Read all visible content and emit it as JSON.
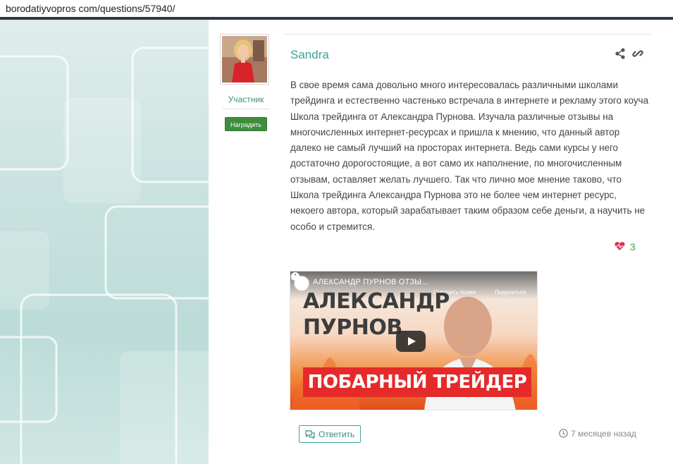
{
  "address_bar": {
    "url": "borodatiyvopros com/questions/57940/"
  },
  "author": {
    "name": "Sandra",
    "role": "Участник",
    "reward_button": "Наградить"
  },
  "answer": {
    "text": "В свое время сама довольно много интересовалась различными школами трейдинга и естественно частенько встречала в интернете и рекламу этого коуча Школа трейдинга от Александра Пурнова. Изучала различные отзывы на многочисленных интернет-ресурсах и пришла к мнению, что данный автор далеко не самый лучший на просторах интернета. Ведь сами курсы у него достаточно дорогостоящие, а вот само их наполнение, по многочисленным отзывам, оставляет желать лучшего. Так что лично мое мнение таково, что Школа трейдинга Александра Пурнова это не более чем интернет ресурс, некоего автора, который зарабатывает таким образом себе деньги, а научить не особо и стремится.",
    "likes": "3",
    "share_icon": "share-icon",
    "link_icon": "link-icon",
    "heart_icon": "heart-icon"
  },
  "video": {
    "title": "АЛЕКСАНДР ПУРНОВ ОТЗЫ...",
    "watch_later": "Смотреть позже",
    "share": "Поделиться",
    "headline_1": "АЛЕКСАНДР",
    "headline_2": "ПУРНОВ",
    "banner": "ПОБАРНЫЙ ТРЕЙДЕР"
  },
  "footer": {
    "reply_button": "Ответить",
    "time": "7 месяцев назад"
  },
  "colors": {
    "accent": "#3aa59a",
    "like_green": "#3aa543",
    "heart_red": "#d9304f",
    "reward_green": "#3f8e3f",
    "banner_red": "#e52a2a"
  }
}
